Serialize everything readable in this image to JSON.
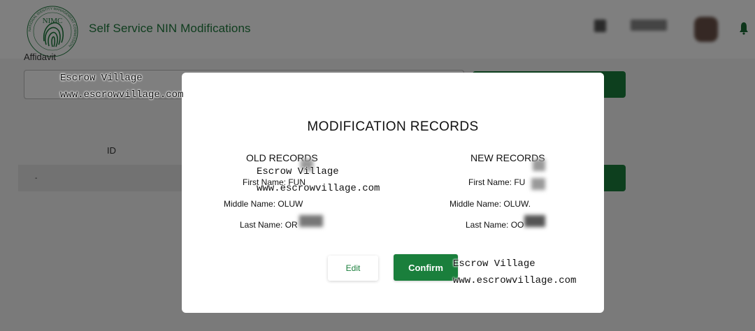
{
  "header": {
    "app_title": "Self Service NIN Modifications",
    "logo_text": "NIMC",
    "logo_ring_text": "NATIONAL IDENTITY MANAGEMENT COMMISSION"
  },
  "background_form": {
    "affidavit_label": "Affidavit",
    "id_label": "ID",
    "id_field_value": "-"
  },
  "modal": {
    "title": "MODIFICATION RECORDS",
    "old": {
      "heading": "OLD RECORDS",
      "first_name": "First Name: FUN",
      "middle_name": "Middle Name: OLUW",
      "last_name": "Last Name: OR"
    },
    "new": {
      "heading": "NEW RECORDS",
      "first_name": "First Name: FU",
      "middle_name": "Middle Name: OLUW.",
      "last_name": "Last Name: OO"
    },
    "edit_label": "Edit",
    "confirm_label": "Confirm"
  },
  "watermark": {
    "name": "Escrow Village",
    "url": "www.escrowvillage.com"
  },
  "colors": {
    "brand_green": "#1a7f3c",
    "title_green": "#1e7a3d",
    "overlay": "rgba(0,0,0,0.5)"
  }
}
